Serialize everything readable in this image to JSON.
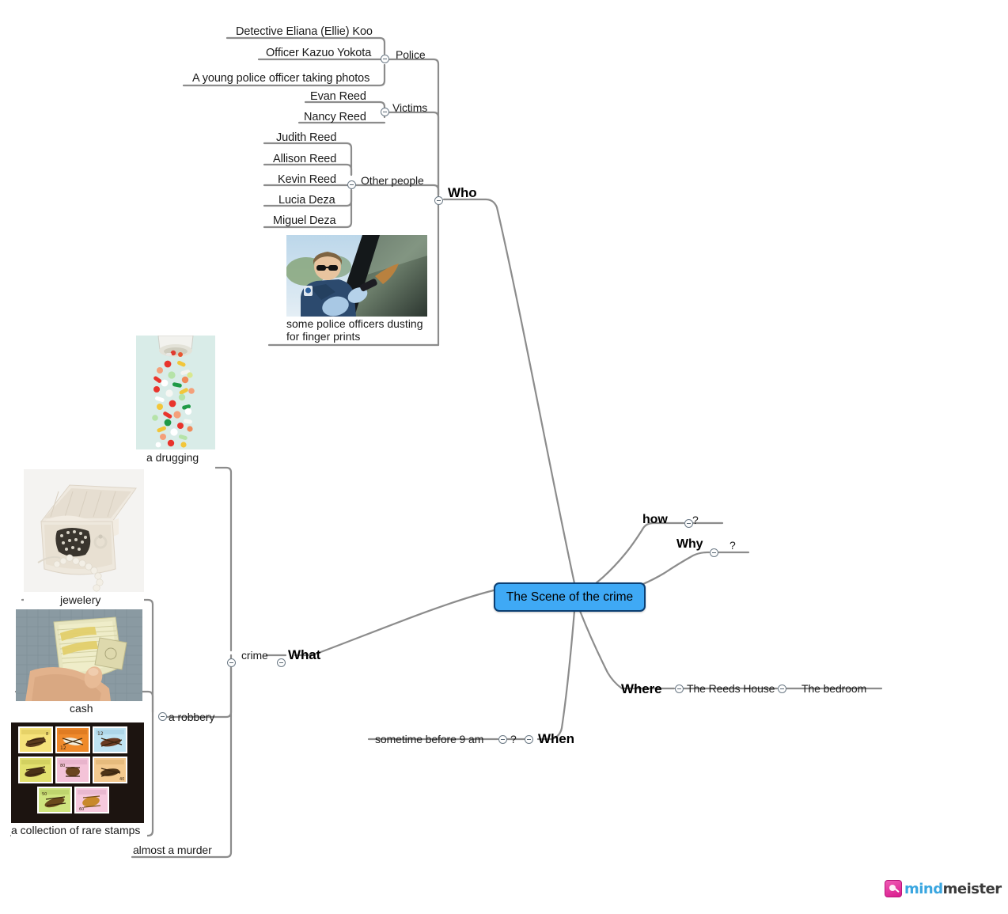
{
  "map": {
    "title": "The Scene of the crime",
    "root_label": "The Scene of the crime",
    "accent_color": "#3fa9f5",
    "root_border_color": "#0b3f73",
    "line_color": "#8c8c8c",
    "text_color": "#1a1a1a"
  },
  "branches": {
    "who": {
      "label": "Who",
      "groups": {
        "police": {
          "label": "Police",
          "items": [
            "Detective Eliana (Ellie) Koo",
            "Officer Kazuo Yokota",
            "A young police officer taking photos"
          ]
        },
        "victims": {
          "label": "Victims",
          "items": [
            "Evan Reed",
            "Nancy Reed"
          ]
        },
        "other_people": {
          "label": "Other people",
          "items": [
            "Judith Reed",
            "Allison Reed",
            "Kevin Reed",
            "Lucia Deza",
            "Miguel Deza"
          ]
        }
      },
      "attachment": {
        "caption_line1": "some police officers dusting",
        "caption_line2": "for finger prints",
        "image_name": "police-officer-dusting-for-fingerprints-photo"
      }
    },
    "what": {
      "label": "What",
      "child": {
        "label": "crime",
        "items": [
          {
            "label": "a drugging",
            "image_name": "spilled-pills-photo"
          },
          {
            "label": "a robbery",
            "items": [
              {
                "label": "jewelery",
                "image_name": "jewelry-box-photo"
              },
              {
                "label": "cash",
                "image_name": "cash-bundle-photo"
              },
              {
                "label": "a collection of rare stamps",
                "image_name": "rare-stamps-sheet-photo"
              }
            ]
          },
          {
            "label": "almost a murder"
          }
        ]
      }
    },
    "how": {
      "label": "how",
      "child": "?"
    },
    "why": {
      "label": "Why",
      "child": "?"
    },
    "where": {
      "label": "Where",
      "child": "The Reeds House",
      "grandchild": "The bedroom"
    },
    "when": {
      "label": "When",
      "child": "?",
      "grandchild": "sometime before 9 am"
    }
  },
  "logo": {
    "part1": "mind",
    "part2": "meister"
  }
}
